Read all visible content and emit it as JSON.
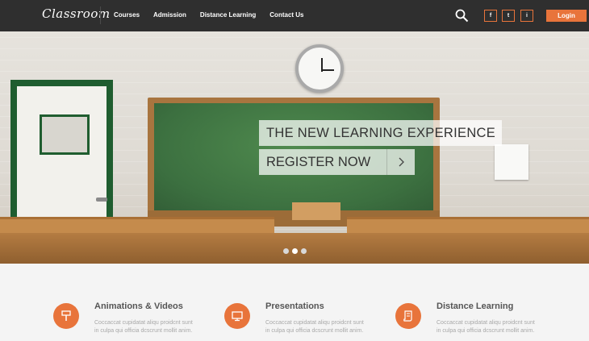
{
  "nav": {
    "logo": "Classroom",
    "links": [
      "Courses",
      "Admission",
      "Distance Learning",
      "Contact Us"
    ],
    "search_icon": "search-icon",
    "social": [
      {
        "name": "facebook-icon",
        "glyph": "f"
      },
      {
        "name": "twitter-icon",
        "glyph": "t"
      },
      {
        "name": "linkedin-icon",
        "glyph": "i"
      }
    ],
    "login_label": "Login",
    "accent": "#e8743b"
  },
  "hero": {
    "headline": "THE NEW LEARNING EXPERIENCE",
    "register_label": "REGISTER NOW",
    "slide_count": 3,
    "active_slide": 2
  },
  "features": [
    {
      "icon": "paint-roller-icon",
      "title": "Animations & Videos",
      "text": "Coccaccat cupidatat aliqu proidcnt sunt in culpa qui officia dcscrunt mollit anim."
    },
    {
      "icon": "monitor-icon",
      "title": "Presentations",
      "text": "Coccaccat cupidatat aliqu proidcnt sunt in culpa qui officia dcscrunt mollit anim."
    },
    {
      "icon": "scroll-document-icon",
      "title": "Distance Learning",
      "text": "Coccaccat cupidatat aliqu proidcnt sunt in culpa qui officia dcscrunt mollit anim."
    }
  ]
}
